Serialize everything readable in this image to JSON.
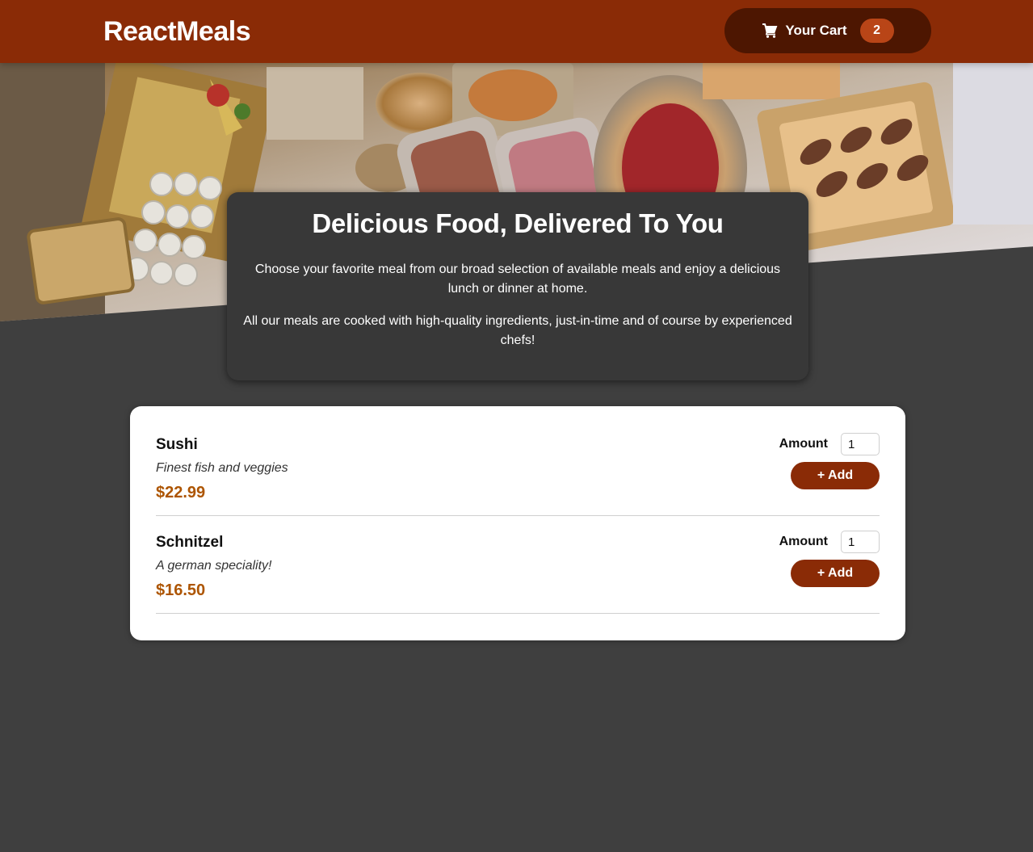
{
  "header": {
    "logo": "ReactMeals",
    "cart": {
      "label": "Your Cart",
      "count": "2"
    }
  },
  "hero": {
    "image": "buffet-table-food-photo"
  },
  "summary": {
    "title": "Delicious Food, Delivered To You",
    "paragraph1": "Choose your favorite meal from our broad selection of available meals and enjoy a delicious lunch or dinner at home.",
    "paragraph2": "All our meals are cooked with high-quality ingredients, just-in-time and of course by experienced chefs!"
  },
  "meals": [
    {
      "name": "Sushi",
      "description": "Finest fish and veggies",
      "price": "$22.99",
      "amount_label": "Amount",
      "amount_value": "1",
      "add_label": "+ Add"
    },
    {
      "name": "Schnitzel",
      "description": "A german speciality!",
      "price": "$16.50",
      "amount_label": "Amount",
      "amount_value": "1",
      "add_label": "+ Add"
    }
  ],
  "colors": {
    "header": "#8a2b06",
    "cart_button": "#4d1601",
    "badge": "#b94517",
    "background": "#3f3f3f",
    "summary_bg": "#383838",
    "price": "#ad5502"
  }
}
